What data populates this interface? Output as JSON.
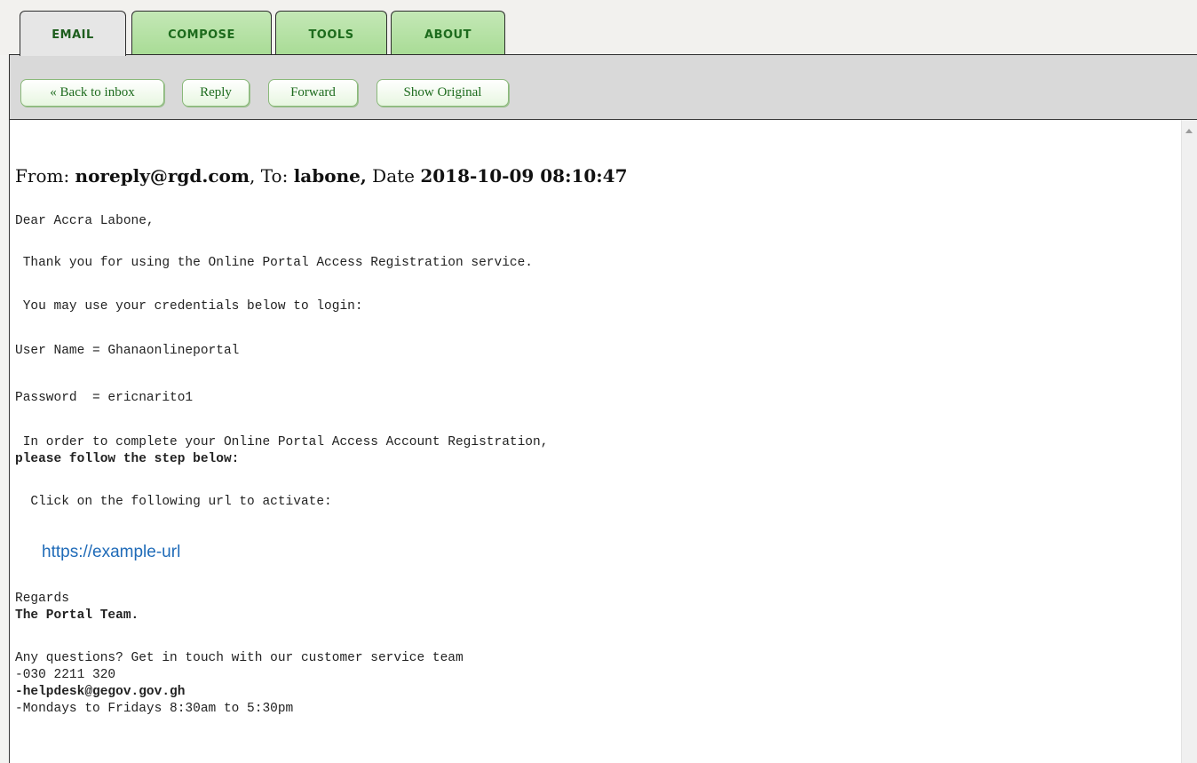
{
  "tabs": [
    {
      "label": "EMAIL",
      "active": true
    },
    {
      "label": "COMPOSE",
      "active": false
    },
    {
      "label": "TOOLS",
      "active": false
    },
    {
      "label": "ABOUT",
      "active": false
    }
  ],
  "toolbar": {
    "back_label": "« Back to inbox",
    "reply_label": "Reply",
    "forward_label": "Forward",
    "show_original_label": "Show Original"
  },
  "email": {
    "from_prefix": "From: ",
    "from": "noreply@rgd.com",
    "to_prefix": ", To: ",
    "to": "labone,",
    "date_prefix": " Date ",
    "date": "2018-10-09 08:10:47",
    "body": {
      "greeting": "Dear Accra Labone,",
      "thanks": " Thank you for using the Online Portal Access Registration service.",
      "credentials_intro": " You may use your credentials below to login:",
      "username": "User Name = Ghanaonlineportal",
      "password": "Password  = ericnarito1",
      "complete_line1": " In order to complete your Online Portal Access Account Registration,",
      "complete_line2": "please follow the step below:",
      "click_line": "  Click on the following url to activate:",
      "url": "https://example-url",
      "regards": "Regards",
      "team": "The Portal Team.",
      "questions": "Any questions? Get in touch with our customer service team",
      "phone": "-030 2211 320",
      "helpdesk": "-helpdesk@gegov.gov.gh",
      "hours": "-Mondays to Fridays 8:30am to 5:30pm"
    }
  },
  "colors": {
    "tab_green": "#a9dc96",
    "tab_text": "#1d6b1d",
    "toolbar_bg": "#d9d9d9",
    "link": "#1f6bb8"
  }
}
